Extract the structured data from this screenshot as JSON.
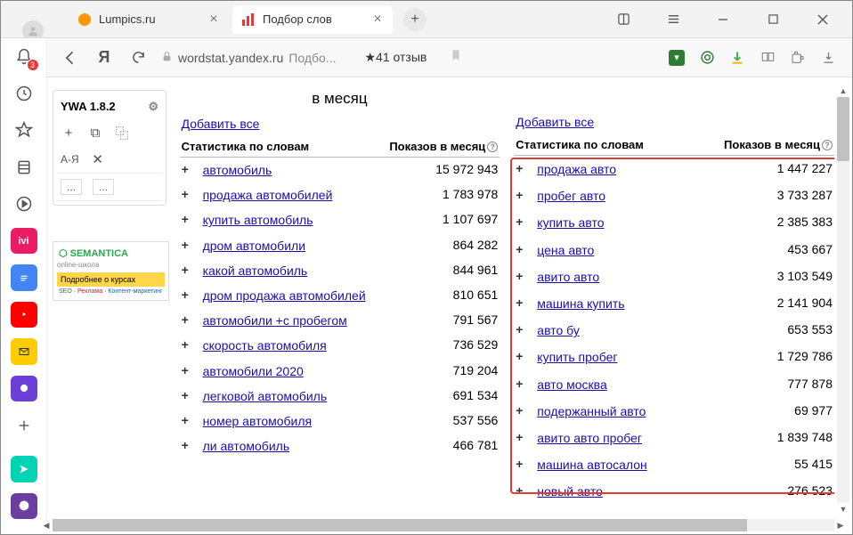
{
  "tabs": [
    {
      "title": "Lumpics.ru",
      "icon_color": "#ff9800"
    },
    {
      "title": "Подбор слов",
      "icon_color": "#e53935"
    }
  ],
  "address": {
    "host": "wordstat.yandex.ru",
    "path": "Подбо..."
  },
  "rating": "41 отзыв",
  "ywa": {
    "title": "YWA 1.8.2",
    "sort": "А-Я"
  },
  "semantica": {
    "name": "SEMANTICA",
    "sub": "online-школа",
    "yellow": "Подробнее о курсах",
    "bottom_g": "SEO",
    "bottom_r": "Реклама",
    "bottom_b": "Контент-маркетинг"
  },
  "month_label": "в месяц",
  "add_all": "Добавить все",
  "thead": {
    "word": "Статистика по словам",
    "num": "Показов в месяц"
  },
  "notif_badge": "3",
  "left": [
    {
      "kw": "автомобиль",
      "num": "15 972 943"
    },
    {
      "kw": "продажа автомобилей",
      "num": "1 783 978"
    },
    {
      "kw": "купить автомобиль",
      "num": "1 107 697"
    },
    {
      "kw": "дром автомобили",
      "num": "864 282"
    },
    {
      "kw": "какой автомобиль",
      "num": "844 961"
    },
    {
      "kw": "дром продажа автомобилей",
      "num": "810 651"
    },
    {
      "kw": "автомобили +с пробегом",
      "num": "791 567"
    },
    {
      "kw": "скорость автомобиля",
      "num": "736 529"
    },
    {
      "kw": "автомобили 2020",
      "num": "719 204"
    },
    {
      "kw": "легковой автомобиль",
      "num": "691 534"
    },
    {
      "kw": "номер автомобиля",
      "num": "537 556"
    },
    {
      "kw": "ли автомобиль",
      "num": "466 781"
    }
  ],
  "right": [
    {
      "kw": "продажа авто",
      "num": "1 447 227"
    },
    {
      "kw": "пробег авто",
      "num": "3 733 287"
    },
    {
      "kw": "купить авто",
      "num": "2 385 383"
    },
    {
      "kw": "цена авто",
      "num": "453 667"
    },
    {
      "kw": "авито авто",
      "num": "3 103 549"
    },
    {
      "kw": "машина купить",
      "num": "2 141 904"
    },
    {
      "kw": "авто бу",
      "num": "653 553"
    },
    {
      "kw": "купить пробег",
      "num": "1 729 786"
    },
    {
      "kw": "авто москва",
      "num": "777 878"
    },
    {
      "kw": "подержанный авто",
      "num": "69 977"
    },
    {
      "kw": "авито авто пробег",
      "num": "1 839 748"
    },
    {
      "kw": "машина автосалон",
      "num": "55 415"
    },
    {
      "kw": "новый авто",
      "num": "276 523"
    }
  ]
}
